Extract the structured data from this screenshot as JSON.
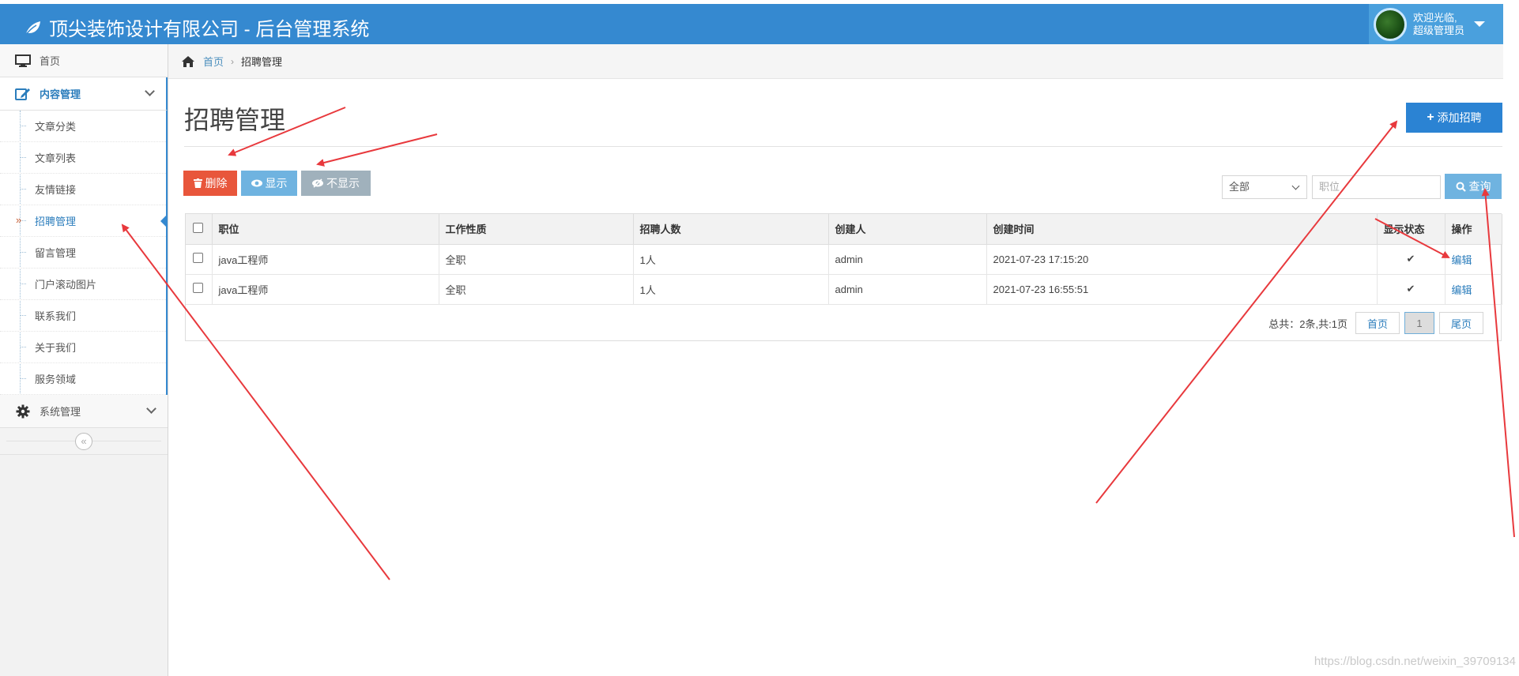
{
  "app": {
    "title": "顶尖装饰设计有限公司 - 后台管理系统",
    "welcome_line1": "欢迎光临,",
    "welcome_line2": "超级管理员"
  },
  "sidebar": {
    "home": "首页",
    "content_group": "内容管理",
    "items": [
      {
        "label": "文章分类"
      },
      {
        "label": "文章列表"
      },
      {
        "label": "友情链接"
      },
      {
        "label": "招聘管理",
        "active": true
      },
      {
        "label": "留言管理"
      },
      {
        "label": "门户滚动图片"
      },
      {
        "label": "联系我们"
      },
      {
        "label": "关于我们"
      },
      {
        "label": "服务领域"
      }
    ],
    "system_group": "系统管理",
    "collapse_glyph": "«"
  },
  "breadcrumb": {
    "home": "首页",
    "current": "招聘管理"
  },
  "page": {
    "title": "招聘管理",
    "add_button": "添加招聘",
    "delete_button": "删除",
    "show_button": "显示",
    "hide_button": "不显示",
    "filter_select": "全部",
    "position_placeholder": "职位",
    "query_button": "查询"
  },
  "table": {
    "headers": [
      "职位",
      "工作性质",
      "招聘人数",
      "创建人",
      "创建时间",
      "显示状态",
      "操作"
    ],
    "rows": [
      {
        "position": "java工程师",
        "nature": "全职",
        "count": "1人",
        "creator": "admin",
        "created": "2021-07-23 17:15:20",
        "status": "✔",
        "action": "编辑"
      },
      {
        "position": "java工程师",
        "nature": "全职",
        "count": "1人",
        "creator": "admin",
        "created": "2021-07-23 16:55:51",
        "status": "✔",
        "action": "编辑"
      }
    ]
  },
  "pager": {
    "summary": "总共：2条,共:1页",
    "first": "首页",
    "current": "1",
    "last": "尾页"
  },
  "watermark": "https://blog.csdn.net/weixin_39709134",
  "colors": {
    "header_blue": "#3589d0",
    "accent_blue": "#2b83d3",
    "danger": "#e8563b",
    "info": "#6fb3e0",
    "muted": "#a0b1bc",
    "annotation_red": "#e8393d"
  }
}
